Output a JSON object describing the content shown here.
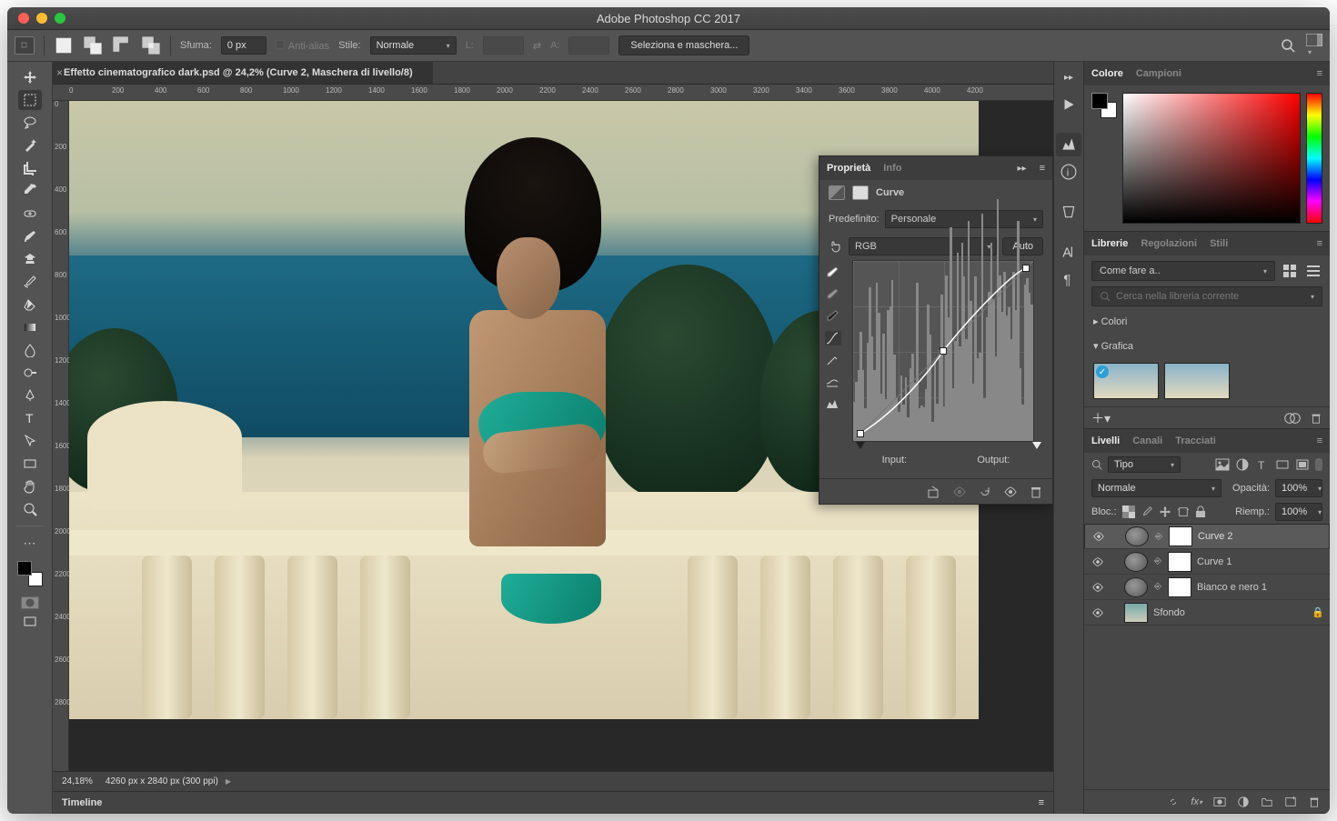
{
  "window": {
    "title": "Adobe Photoshop CC 2017"
  },
  "optbar": {
    "sfuma_label": "Sfuma:",
    "sfuma_value": "0 px",
    "antialias": "Anti-alias",
    "stile_label": "Stile:",
    "stile_value": "Normale",
    "l_label": "L:",
    "a_label": "A:",
    "mask_btn": "Seleziona e maschera..."
  },
  "doc": {
    "tab": "Effetto cinematografico dark.psd @ 24,2% (Curve 2, Maschera di livello/8)",
    "zoom": "24,18%",
    "dims": "4260 px x 2840 px (300 ppi)"
  },
  "rulerH": [
    "0",
    "200",
    "400",
    "600",
    "800",
    "1000",
    "1200",
    "1400",
    "1600",
    "1800",
    "2000",
    "2200",
    "2400",
    "2600",
    "2800",
    "3000",
    "3200",
    "3400",
    "3600",
    "3800",
    "4000",
    "4200"
  ],
  "rulerV": [
    "0",
    "200",
    "400",
    "600",
    "800",
    "1000",
    "1200",
    "1400",
    "1600",
    "1800",
    "2000",
    "2200",
    "2400",
    "2600",
    "2800"
  ],
  "timeline": {
    "label": "Timeline"
  },
  "properties": {
    "tab_prop": "Proprietà",
    "tab_info": "Info",
    "adj_name": "Curve",
    "preset_label": "Predefinito:",
    "preset_value": "Personale",
    "channel_value": "RGB",
    "auto_btn": "Auto",
    "input_label": "Input:",
    "output_label": "Output:"
  },
  "colorPanel": {
    "tab_color": "Colore",
    "tab_swatch": "Campioni"
  },
  "libPanel": {
    "tab_lib": "Librerie",
    "tab_adj": "Regolazioni",
    "tab_styles": "Stili",
    "dropdown": "Come fare a..",
    "search_placeholder": "Cerca nella libreria corrente",
    "sec_colori": "Colori",
    "sec_grafica": "Grafica"
  },
  "layersPanel": {
    "tab_layers": "Livelli",
    "tab_channels": "Canali",
    "tab_paths": "Tracciati",
    "filter_label": "Tipo",
    "blend_value": "Normale",
    "opacity_label": "Opacità:",
    "opacity_value": "100%",
    "lock_label": "Bloc.:",
    "fill_label": "Riemp.:",
    "fill_value": "100%",
    "layers": [
      {
        "name": "Curve 2",
        "type": "adj",
        "selected": true
      },
      {
        "name": "Curve 1",
        "type": "adj",
        "selected": false
      },
      {
        "name": "Bianco e nero 1",
        "type": "adj",
        "selected": false
      },
      {
        "name": "Sfondo",
        "type": "bg",
        "selected": false,
        "locked": true
      }
    ]
  }
}
